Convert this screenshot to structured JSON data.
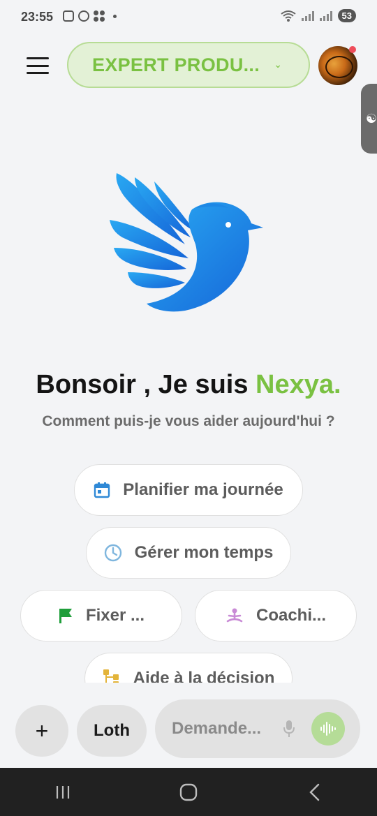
{
  "status_bar": {
    "time": "23:55",
    "battery": "53",
    "icons": [
      "screenshot-icon",
      "whatsapp-icon",
      "apps-icon",
      "notification-dot",
      "wifi-icon",
      "signal-icon",
      "signal-icon",
      "battery-icon"
    ]
  },
  "header": {
    "mode_label": "EXPERT PRODU...",
    "mode_icon": "chevron-down-icon",
    "avatar_badge_color": "#ef4d5a"
  },
  "greeting": {
    "prefix": "Bonsoir , Je suis ",
    "name": "Nexya.",
    "subtitle": "Comment puis-je vous aider aujourd'hui ?"
  },
  "suggestions": [
    {
      "label": "Planifier ma journée",
      "icon": "calendar-icon"
    },
    {
      "label": "Gérer mon temps",
      "icon": "clock-icon"
    },
    {
      "label": "Fixer ...",
      "icon": "flag-icon"
    },
    {
      "label": "Coachi...",
      "icon": "meditation-icon"
    },
    {
      "label": "Aide à la décision",
      "icon": "decision-tree-icon"
    }
  ],
  "composer": {
    "plus_label": "+",
    "language_label": "Loth",
    "placeholder": "Demande...",
    "mic_icon": "microphone-icon",
    "voice_icon": "voice-wave-icon"
  },
  "colors": {
    "accent": "#7ac142",
    "accent_light": "#e3f1d6",
    "logo_blue": "#1e88e5"
  }
}
